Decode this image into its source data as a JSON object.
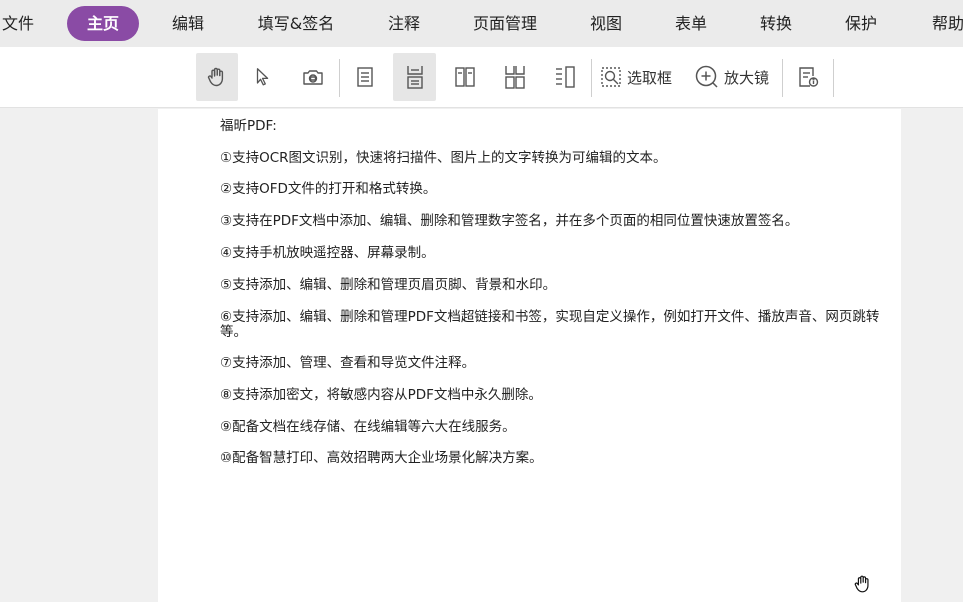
{
  "menu": {
    "items": [
      {
        "label": "文件"
      },
      {
        "label": "主页",
        "active": true
      },
      {
        "label": "编辑"
      },
      {
        "label": "填写&签名"
      },
      {
        "label": "注释"
      },
      {
        "label": "页面管理"
      },
      {
        "label": "视图"
      },
      {
        "label": "表单"
      },
      {
        "label": "转换"
      },
      {
        "label": "保护"
      },
      {
        "label": "帮助"
      }
    ],
    "active_color": "#8a4ba5"
  },
  "toolbar": {
    "hand_tool": "hand-icon",
    "select_tool": "cursor-arrow-icon",
    "snapshot_tool": "camera-icon",
    "single_page": "single-page-icon",
    "continuous_page": "continuous-page-icon",
    "facing_page": "facing-page-icon",
    "continuous_facing": "continuous-facing-icon",
    "separate_cover": "separate-cover-icon",
    "marquee_label": "选取框",
    "loupe_label": "放大镜",
    "properties_icon": "document-properties-icon"
  },
  "document": {
    "lines": [
      "福昕PDF:",
      "①支持OCR图文识别，快速将扫描件、图片上的文字转换为可编辑的文本。",
      "②支持OFD文件的打开和格式转换。",
      "③支持在PDF文档中添加、编辑、删除和管理数字签名，并在多个页面的相同位置快速放置签名。",
      "④支持手机放映遥控器、屏幕录制。",
      "⑤支持添加、编辑、删除和管理页眉页脚、背景和水印。",
      "⑥支持添加、编辑、删除和管理PDF文档超链接和书签，实现自定义操作，例如打开文件、播放声音、网页跳转等。",
      "⑦支持添加、管理、查看和导览文件注释。",
      "⑧支持添加密文，将敏感内容从PDF文档中永久删除。",
      "⑨配备文档在线存储、在线编辑等六大在线服务。",
      "⑩配备智慧打印、高效招聘两大企业场景化解决方案。"
    ]
  }
}
